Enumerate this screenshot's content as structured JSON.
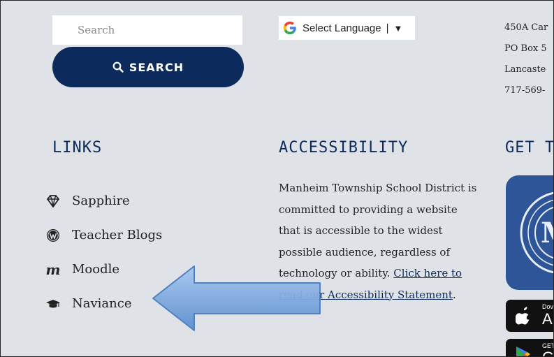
{
  "search": {
    "placeholder": "Search",
    "button_label": "SEARCH"
  },
  "translate": {
    "label": "Select Language",
    "separator": "|",
    "dropdown_glyph": "▼"
  },
  "address": {
    "lines": [
      "450A Car",
      "PO Box 5",
      "Lancaste",
      "717-569-"
    ]
  },
  "links": {
    "heading": "LINKS",
    "items": [
      {
        "label": "Sapphire",
        "icon": "diamond-icon"
      },
      {
        "label": "Teacher Blogs",
        "icon": "wordpress-icon"
      },
      {
        "label": "Moodle",
        "icon": "moodle-icon",
        "glyph": "m"
      },
      {
        "label": "Naviance",
        "icon": "graduation-cap-icon"
      }
    ]
  },
  "accessibility": {
    "heading": "ACCESSIBILITY",
    "body": "Manheim Township School District is committed to providing a website that is accessible to the widest possible audience, regardless of technology or ability.",
    "link_text": "Click here to read our Accessibility Statement",
    "trailing": "."
  },
  "app": {
    "heading": "GET TH",
    "app_store_small": "Dov",
    "app_store_large": "Ap",
    "play_store_small": "GET",
    "play_store_large": "G"
  },
  "colors": {
    "navy": "#0d2a5c",
    "background": "#dfe3e8",
    "arrow_fill": "#6f9fd8"
  }
}
